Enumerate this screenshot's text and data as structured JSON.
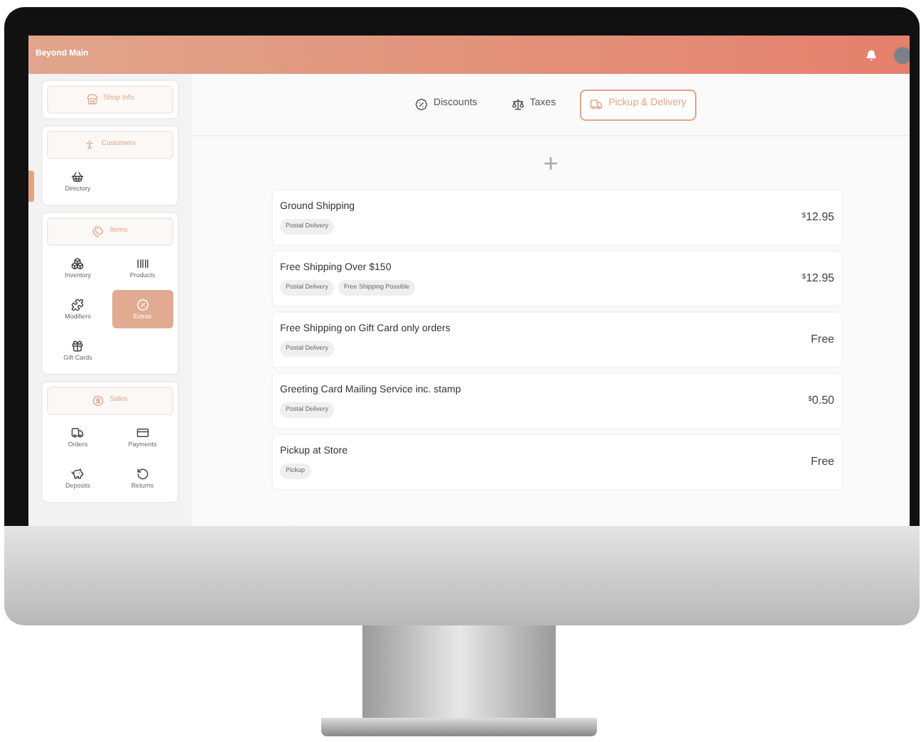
{
  "app": {
    "title": "Beyond Main"
  },
  "sidebar": [
    {
      "label": "Shop Info"
    },
    {
      "label": "Customers",
      "items": [
        {
          "label": "Directory",
          "selected": false
        }
      ]
    },
    {
      "label": "Items",
      "items": [
        {
          "label": "Inventory",
          "selected": false
        },
        {
          "label": "Products",
          "selected": false
        },
        {
          "label": "Modifiers",
          "selected": false
        },
        {
          "label": "Extras",
          "selected": true
        },
        {
          "label": "Gift Cards",
          "selected": false
        }
      ]
    },
    {
      "label": "Sales",
      "items": [
        {
          "label": "Orders",
          "selected": false
        },
        {
          "label": "Payments",
          "selected": false
        },
        {
          "label": "Deposits",
          "selected": false
        },
        {
          "label": "Returns",
          "selected": false
        }
      ]
    }
  ],
  "tabs": [
    {
      "label": "Discounts",
      "selected": false
    },
    {
      "label": "Taxes",
      "selected": false
    },
    {
      "label": "Pickup & Delivery",
      "selected": true
    }
  ],
  "add_button": {
    "label": "+"
  },
  "methods": [
    {
      "name": "Ground Shipping",
      "tags": [
        "Postal Delivery"
      ],
      "currency": "$",
      "price": "12.95"
    },
    {
      "name": "Free Shipping Over $150",
      "tags": [
        "Postal Delivery",
        "Free Shipping Possible"
      ],
      "currency": "$",
      "price": "12.95"
    },
    {
      "name": "Free Shipping on Gift Card only orders",
      "tags": [
        "Postal Delivery"
      ],
      "price": "Free"
    },
    {
      "name": "Greeting Card Mailing Service inc. stamp",
      "tags": [
        "Postal Delivery"
      ],
      "currency": "$",
      "price": "0.50"
    },
    {
      "name": "Pickup at Store",
      "tags": [
        "Pickup"
      ],
      "price": "Free"
    }
  ]
}
